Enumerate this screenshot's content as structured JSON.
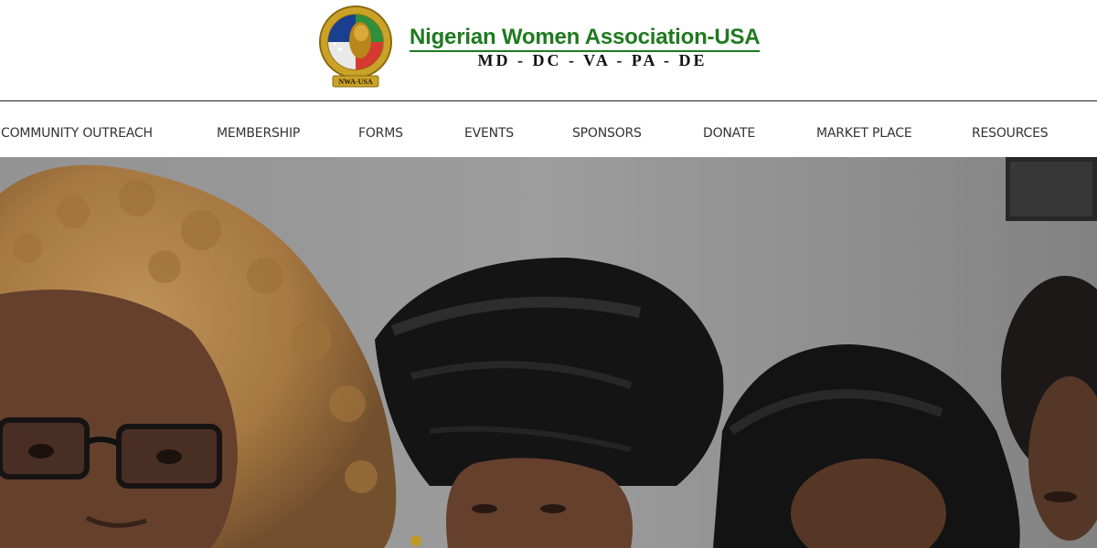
{
  "header": {
    "logo_name": "nwa-logo",
    "logo_ring_text": "NIGERIAN WOMEN ASSOCIATION USA",
    "logo_ribbon_text": "NWA-USA",
    "title": "Nigerian Women Association-USA",
    "subtitle": "MD - DC - VA - PA - DE"
  },
  "nav": {
    "items": [
      {
        "label": "COMMUNITY OUTREACH"
      },
      {
        "label": "MEMBERSHIP"
      },
      {
        "label": "FORMS"
      },
      {
        "label": "EVENTS"
      },
      {
        "label": "SPONSORS"
      },
      {
        "label": "DONATE"
      },
      {
        "label": "MARKET PLACE"
      },
      {
        "label": "RESOURCES"
      }
    ]
  },
  "colors": {
    "brand_green": "#1f7a1f",
    "logo_gold": "#c9a227",
    "nav_text": "#333333"
  },
  "hero": {
    "image": "group-photo-of-women-in-headwraps"
  }
}
